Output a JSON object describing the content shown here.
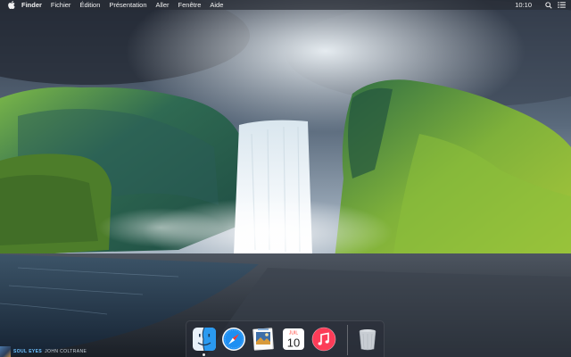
{
  "menubar": {
    "app_name": "Finder",
    "items": [
      "Fichier",
      "Édition",
      "Présentation",
      "Aller",
      "Fenêtre",
      "Aide"
    ],
    "clock": "10:10"
  },
  "dock": {
    "apps": [
      {
        "name": "Finder",
        "icon": "finder-icon",
        "running": true
      },
      {
        "name": "Safari",
        "icon": "safari-icon",
        "running": false
      },
      {
        "name": "Preview",
        "icon": "preview-icon",
        "running": false
      },
      {
        "name": "Calendar",
        "icon": "calendar-icon",
        "running": false
      },
      {
        "name": "iTunes",
        "icon": "itunes-icon",
        "running": false
      },
      {
        "name": "Trash",
        "icon": "trash-icon",
        "running": false
      }
    ],
    "calendar": {
      "month": "JUIL",
      "day": "10"
    }
  },
  "nowplaying": {
    "title": "SOUL EYES",
    "artist": "JOHN COLTRANE"
  },
  "colors": {
    "menubar_bg": "#2c2f36",
    "itunes_red": "#fc3c58",
    "safari_blue": "#1e8ff2",
    "finder_blue": "#2a9af0",
    "nowplaying_title": "#6fc2ff"
  }
}
